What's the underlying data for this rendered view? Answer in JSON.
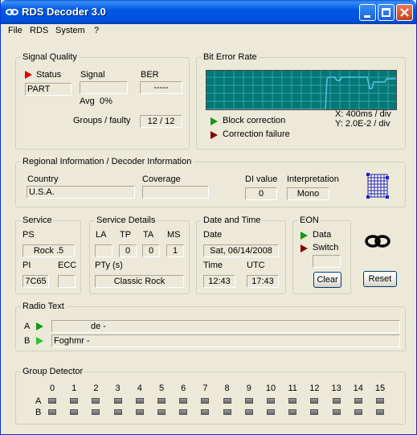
{
  "window": {
    "title": "RDS Decoder 3.0"
  },
  "menu": {
    "file": "File",
    "rds": "RDS",
    "system": "System",
    "help": "?"
  },
  "signal_quality": {
    "title": "Signal Quality",
    "status_label": "Status",
    "status_value": "PART",
    "signal_label": "Signal",
    "signal_value": "",
    "ber_label": "BER",
    "ber_value": "-----",
    "avg_label": "Avg",
    "avg_value": "0%",
    "groups_label": "Groups / faulty",
    "groups_value": "12 / 12"
  },
  "bit_error_rate": {
    "title": "Bit Error Rate",
    "x_scale": "X: 400ms / div",
    "y_scale": "Y: 2.0E-2 / div",
    "block_correction": "Block correction",
    "correction_failure": "Correction failure",
    "colors": {
      "background": "#007878",
      "grid": "#40a0a0",
      "line": "#60c0e0"
    }
  },
  "regional": {
    "title": "Regional Information / Decoder Information",
    "country_label": "Country",
    "country_value": "U.S.A.",
    "coverage_label": "Coverage",
    "coverage_value": "",
    "di_label": "DI value",
    "di_value": "0",
    "interp_label": "Interpretation",
    "interp_value": "Mono"
  },
  "service": {
    "title": "Service",
    "ps_label": "PS",
    "ps_value": "Rock .5",
    "pi_label": "PI",
    "pi_value": "7C65",
    "ecc_label": "ECC",
    "ecc_value": ""
  },
  "service_details": {
    "title": "Service Details",
    "la_label": "LA",
    "tp_label": "TP",
    "ta_label": "TA",
    "ms_label": "MS",
    "la_value": "",
    "tp_value": "0",
    "ta_value": "0",
    "ms_value": "1",
    "pty_label": "PTy (s)",
    "pty_value": "Classic Rock"
  },
  "date_time": {
    "title": "Date and Time",
    "date_label": "Date",
    "date_value": "Sat, 06/14/2008",
    "time_label": "Time",
    "time_value": "12:43",
    "utc_label": "UTC",
    "utc_value": "17:43"
  },
  "eon": {
    "title": "EON",
    "data_label": "Data",
    "switch_label": "Switch",
    "switch_value": "",
    "clear_label": "Clear"
  },
  "reset_label": "Reset",
  "radio_text": {
    "title": "Radio Text",
    "a_label": "A",
    "a_value": "de -",
    "b_label": "B",
    "b_value": "Foghmr -"
  },
  "group_detector": {
    "title": "Group Detector",
    "row_a": "A",
    "row_b": "B",
    "columns": [
      "0",
      "1",
      "2",
      "3",
      "4",
      "5",
      "6",
      "7",
      "8",
      "9",
      "10",
      "11",
      "12",
      "13",
      "14",
      "15"
    ]
  }
}
